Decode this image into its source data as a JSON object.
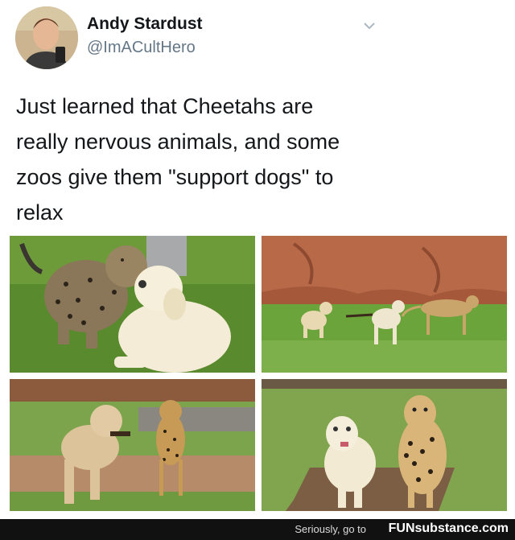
{
  "tweet": {
    "author_name": "Andy Stardust",
    "author_handle": "@ImACultHero",
    "text_lines": [
      "Just learned that Cheetahs are",
      "really nervous animals, and some",
      "zoos give them \"support dogs\" to",
      "relax"
    ]
  },
  "photos": [
    {
      "subject": "cheetah-cub-with-puppy"
    },
    {
      "subject": "dogs-running-with-cheetah"
    },
    {
      "subject": "dog-and-cheetah-walking"
    },
    {
      "subject": "dog-and-cheetah-sitting"
    }
  ],
  "footer": {
    "text": "Seriously, go to",
    "logo": "FUNsubstance.com"
  },
  "colors": {
    "text": "#14171a",
    "handle": "#657786",
    "footer_bg": "#111111"
  }
}
